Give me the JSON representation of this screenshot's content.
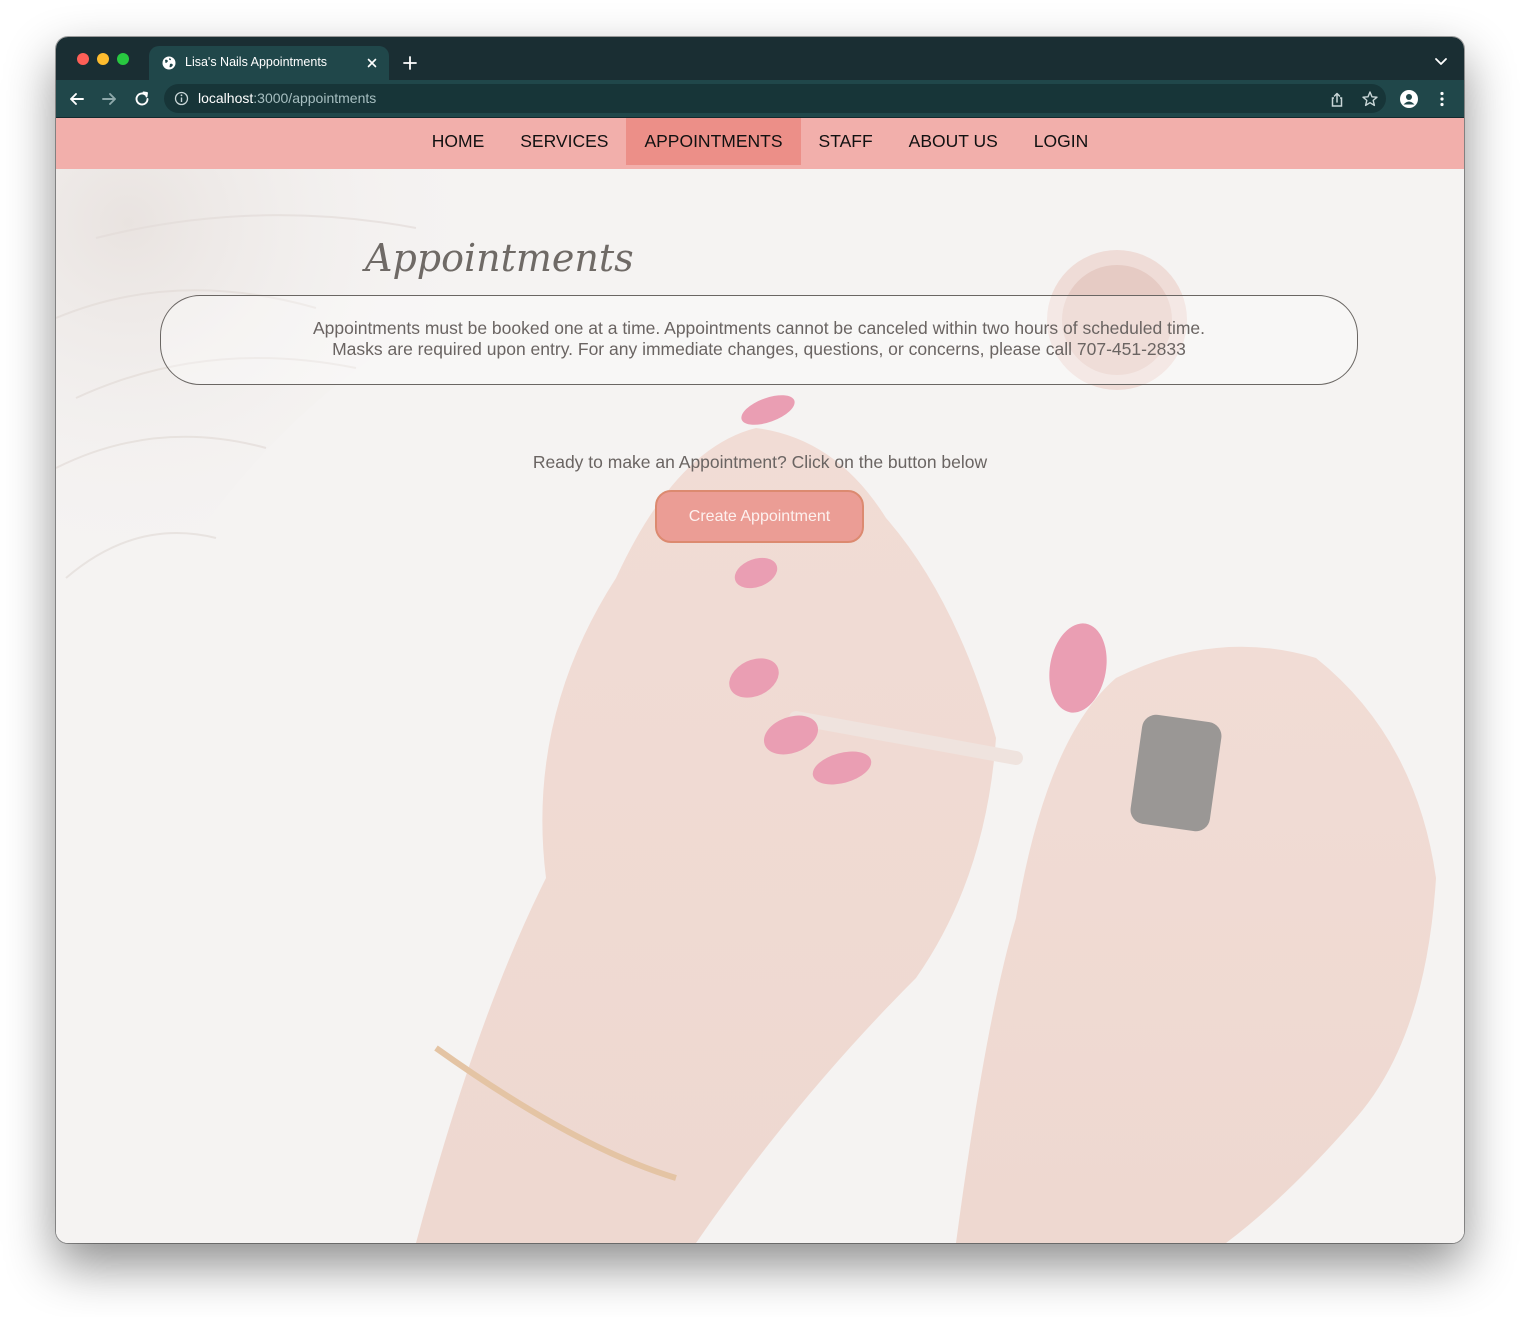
{
  "browser": {
    "tab_title": "Lisa's Nails Appointments",
    "url_host": "localhost",
    "url_path": ":3000/appointments"
  },
  "nav": {
    "items": [
      "HOME",
      "SERVICES",
      "APPOINTMENTS",
      "STAFF",
      "ABOUT US",
      "LOGIN"
    ],
    "active": "APPOINTMENTS"
  },
  "main": {
    "title": "Appointments",
    "notice_line1": "Appointments must be booked one at a time. Appointments cannot be canceled within two hours of scheduled time.",
    "notice_line2": "Masks are required upon entry. For any immediate changes, questions, or concerns, please call 707-451-2833",
    "cta_text": "Ready to make an Appointment? Click on the button below",
    "create_button": "Create Appointment"
  },
  "colors": {
    "tab_strip": "#1a2e33",
    "toolbar": "#20474a",
    "navbar": "#f2afab",
    "nav_active": "#ec8f88",
    "button_fill": "#eb9d95",
    "button_border": "#dc8a70"
  }
}
